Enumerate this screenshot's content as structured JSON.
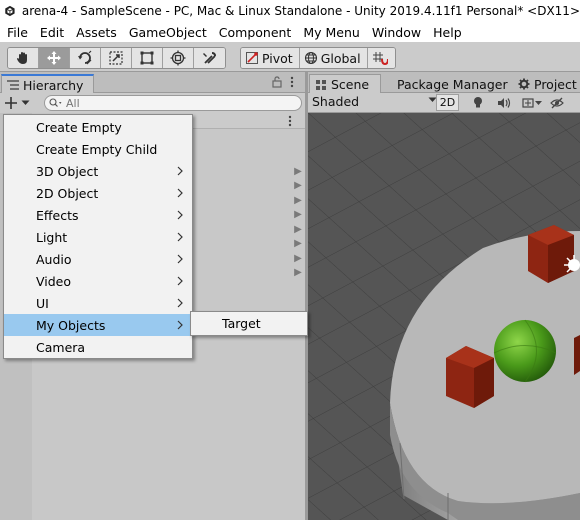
{
  "window": {
    "title": "arena-4 - SampleScene - PC, Mac & Linux Standalone - Unity 2019.4.11f1 Personal* <DX11>"
  },
  "menubar": {
    "items": [
      "File",
      "Edit",
      "Assets",
      "GameObject",
      "Component",
      "My Menu",
      "Window",
      "Help"
    ]
  },
  "toolbar": {
    "tools": [
      "hand-tool-icon",
      "move-tool-icon",
      "rotate-tool-icon",
      "scale-tool-icon",
      "rect-tool-icon",
      "transform-tool-icon",
      "custom-tool-icon"
    ],
    "active_tool": "move-tool-icon",
    "pivot_label": "Pivot",
    "global_label": "Global"
  },
  "hierarchy": {
    "tab_label": "Hierarchy",
    "search_placeholder": "All"
  },
  "scene": {
    "tabs": [
      {
        "label": "Scene",
        "icon": "scene-icon"
      },
      {
        "label": "Package Manager",
        "icon": ""
      },
      {
        "label": "Project S",
        "icon": "gear-icon"
      }
    ],
    "shading_mode": "Shaded",
    "mode_2d_label": "2D"
  },
  "create_menu": {
    "items": [
      {
        "label": "Create Empty",
        "has_submenu": false
      },
      {
        "label": "Create Empty Child",
        "has_submenu": false
      },
      {
        "label": "3D Object",
        "has_submenu": true
      },
      {
        "label": "2D Object",
        "has_submenu": true
      },
      {
        "label": "Effects",
        "has_submenu": true
      },
      {
        "label": "Light",
        "has_submenu": true
      },
      {
        "label": "Audio",
        "has_submenu": true
      },
      {
        "label": "Video",
        "has_submenu": true
      },
      {
        "label": "UI",
        "has_submenu": true
      },
      {
        "label": "My Objects",
        "has_submenu": true,
        "highlighted": true
      },
      {
        "label": "Camera",
        "has_submenu": false
      }
    ],
    "submenu_items": [
      "Target"
    ]
  },
  "colors": {
    "highlight": "#99c9ef",
    "tab_accent": "#3a79d6",
    "floor": "#b8b8b8",
    "cube": "#8e2512",
    "sphere": "#4a9a1a"
  }
}
